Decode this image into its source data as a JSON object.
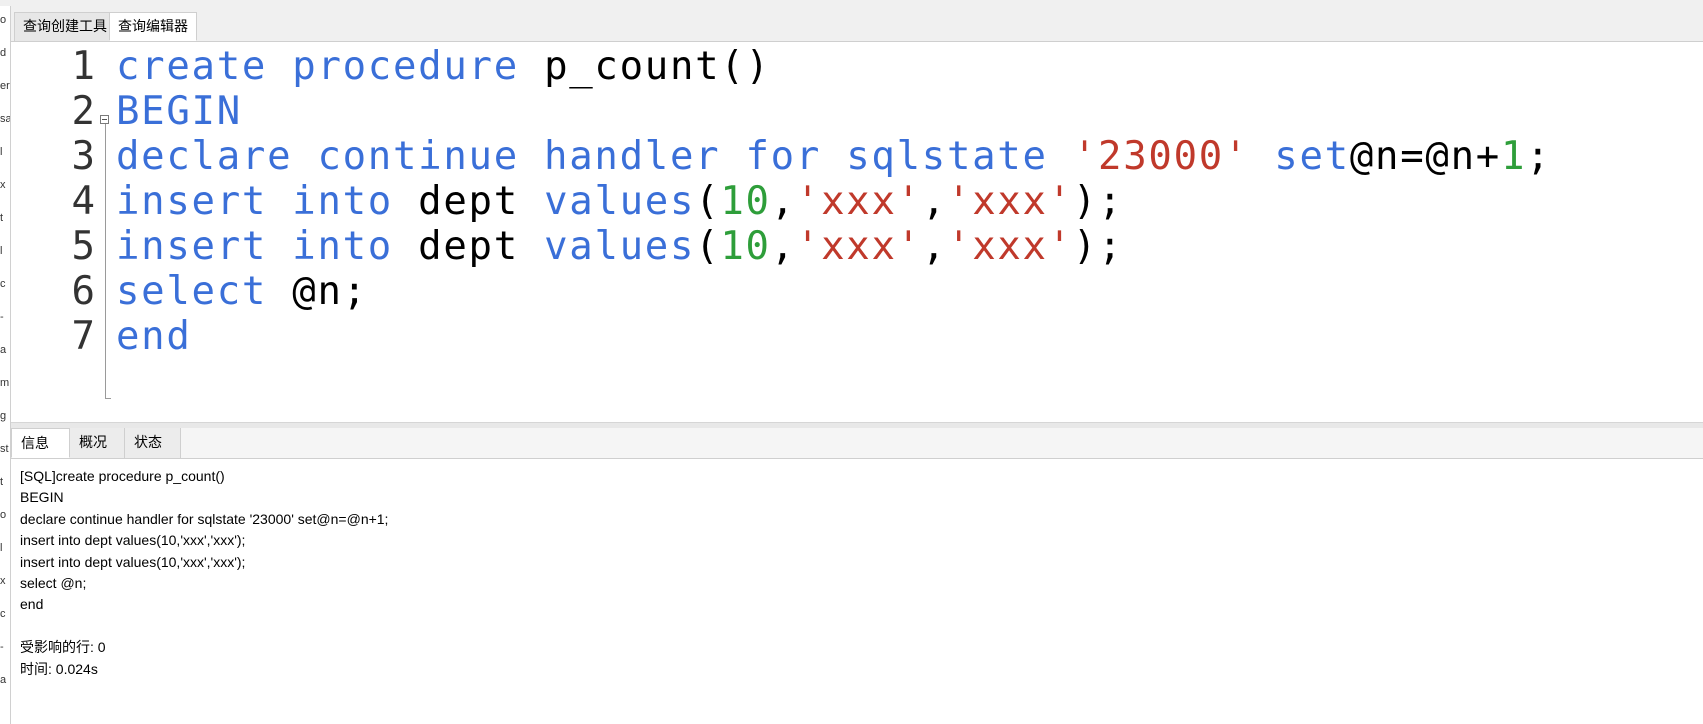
{
  "left_pane": {
    "fragments": [
      "o",
      "d",
      "er",
      "sa",
      "l",
      "x",
      "t",
      "l",
      "c",
      "-",
      "a",
      "m",
      "g",
      "st",
      "t",
      "o",
      "l",
      "x",
      "c",
      "-",
      "a"
    ]
  },
  "editor_tabs": [
    {
      "label": "查询创建工具"
    },
    {
      "label": "查询编辑器"
    }
  ],
  "editor": {
    "lines": [
      {
        "num": "1",
        "tokens": [
          {
            "t": "kw",
            "v": "create procedure "
          },
          {
            "t": "plain",
            "v": "p_count()"
          }
        ]
      },
      {
        "num": "2",
        "tokens": [
          {
            "t": "kw",
            "v": "BEGIN"
          }
        ]
      },
      {
        "num": "3",
        "tokens": [
          {
            "t": "kw",
            "v": "declare continue handler for sqlstate "
          },
          {
            "t": "str",
            "v": "'23000'"
          },
          {
            "t": "kw",
            "v": " set"
          },
          {
            "t": "plain",
            "v": "@n=@n+"
          },
          {
            "t": "num",
            "v": "1"
          },
          {
            "t": "plain",
            "v": ";"
          }
        ]
      },
      {
        "num": "4",
        "tokens": [
          {
            "t": "kw",
            "v": "insert into "
          },
          {
            "t": "plain",
            "v": "dept "
          },
          {
            "t": "kw",
            "v": "values"
          },
          {
            "t": "plain",
            "v": "("
          },
          {
            "t": "num",
            "v": "10"
          },
          {
            "t": "plain",
            "v": ","
          },
          {
            "t": "str",
            "v": "'xxx'"
          },
          {
            "t": "plain",
            "v": ","
          },
          {
            "t": "str",
            "v": "'xxx'"
          },
          {
            "t": "plain",
            "v": ");"
          }
        ]
      },
      {
        "num": "5",
        "tokens": [
          {
            "t": "kw",
            "v": "insert into "
          },
          {
            "t": "plain",
            "v": "dept "
          },
          {
            "t": "kw",
            "v": "values"
          },
          {
            "t": "plain",
            "v": "("
          },
          {
            "t": "num",
            "v": "10"
          },
          {
            "t": "plain",
            "v": ","
          },
          {
            "t": "str",
            "v": "'xxx'"
          },
          {
            "t": "plain",
            "v": ","
          },
          {
            "t": "str",
            "v": "'xxx'"
          },
          {
            "t": "plain",
            "v": ");"
          }
        ]
      },
      {
        "num": "6",
        "tokens": [
          {
            "t": "kw",
            "v": "select "
          },
          {
            "t": "plain",
            "v": "@n;"
          }
        ]
      },
      {
        "num": "7",
        "tokens": [
          {
            "t": "kw",
            "v": "end"
          }
        ]
      }
    ]
  },
  "result_tabs": [
    {
      "label": "信息"
    },
    {
      "label": "概况"
    },
    {
      "label": "状态"
    }
  ],
  "messages": {
    "lines": [
      "[SQL]create procedure p_count()",
      "BEGIN",
      "declare continue handler for sqlstate '23000' set@n=@n+1;",
      "insert into dept values(10,'xxx','xxx');",
      "insert into dept values(10,'xxx','xxx');",
      "select @n;",
      "end",
      "",
      "受影响的行: 0",
      "时间: 0.024s"
    ]
  },
  "colors": {
    "keyword": "#3a6fd8",
    "string": "#c0392b",
    "number": "#2e9e3a",
    "plain": "#000000"
  }
}
